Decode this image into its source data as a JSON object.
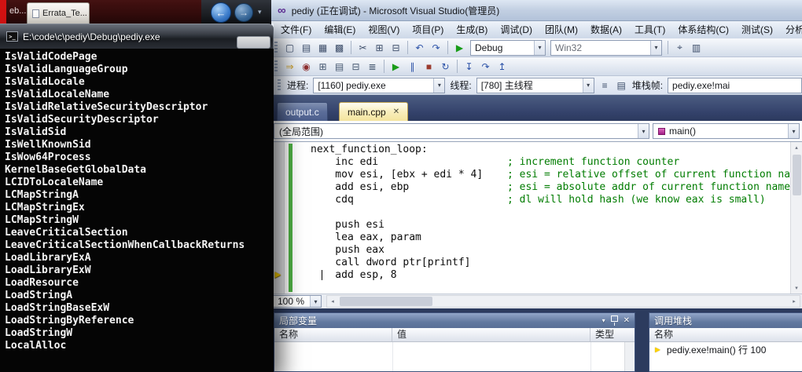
{
  "ui": {
    "dropdown_glyph": "▾",
    "close_glyph": "✕",
    "scroll_left": "◂",
    "scroll_right": "▸",
    "scroll_up": "▴",
    "scroll_down": "▾"
  },
  "background": {
    "edge_tab_label": "eb...",
    "tab_label": "Errata_Te...",
    "back_glyph": "←",
    "forward_glyph": "→",
    "chevron_glyph": "▾"
  },
  "console": {
    "icon_glyph": ">_",
    "title": "E:\\code\\c\\pediy\\Debug\\pediy.exe",
    "lines": [
      "IsValidCodePage",
      "IsValidLanguageGroup",
      "IsValidLocale",
      "IsValidLocaleName",
      "IsValidRelativeSecurityDescriptor",
      "IsValidSecurityDescriptor",
      "IsValidSid",
      "IsWellKnownSid",
      "IsWow64Process",
      "KernelBaseGetGlobalData",
      "LCIDToLocaleName",
      "LCMapStringA",
      "LCMapStringEx",
      "LCMapStringW",
      "LeaveCriticalSection",
      "LeaveCriticalSectionWhenCallbackReturns",
      "LoadLibraryExA",
      "LoadLibraryExW",
      "LoadResource",
      "LoadStringA",
      "LoadStringBaseExW",
      "LoadStringByReference",
      "LoadStringW",
      "LocalAlloc"
    ]
  },
  "vs": {
    "logo_glyph": "∞",
    "title": "pediy (正在调试) - Microsoft Visual Studio(管理员)",
    "menus": [
      "文件(F)",
      "编辑(E)",
      "视图(V)",
      "项目(P)",
      "生成(B)",
      "调试(D)",
      "团队(M)",
      "数据(A)",
      "工具(T)",
      "体系结构(C)",
      "测试(S)",
      "分析(N)"
    ],
    "toolbar_main": {
      "file_icons": [
        {
          "name": "new-file-icon",
          "glyph": "▢"
        },
        {
          "name": "open-file-icon",
          "glyph": "▤"
        },
        {
          "name": "save-icon",
          "glyph": "▦"
        },
        {
          "name": "save-all-icon",
          "glyph": "▩"
        }
      ],
      "edit_icons": [
        {
          "name": "cut-icon",
          "glyph": "✂"
        },
        {
          "name": "copy-icon",
          "glyph": "⊞"
        },
        {
          "name": "paste-icon",
          "glyph": "⊟"
        }
      ],
      "history_icons": [
        {
          "name": "undo-icon",
          "glyph": "↶",
          "color": "#2d53a8"
        },
        {
          "name": "redo-icon",
          "glyph": "↷",
          "color": "#2d53a8"
        }
      ],
      "start_glyph": "▶",
      "config_value": "Debug",
      "platform_value": "Win32",
      "tool_icons": [
        {
          "name": "find-in-files-icon",
          "glyph": "⌖"
        },
        {
          "name": "solution-explorer-icon",
          "glyph": "▥"
        }
      ]
    },
    "toolbar_debug": {
      "window_icons": [
        {
          "name": "show-next-statement-icon",
          "glyph": "⇒",
          "color": "#c9991c"
        },
        {
          "name": "breakpoints-window-icon",
          "glyph": "◉",
          "color": "#8d2f2f"
        },
        {
          "name": "immediate-window-icon",
          "glyph": "⊞",
          "color": "#44566e"
        },
        {
          "name": "locals-window-icon",
          "glyph": "▤",
          "color": "#44566e"
        },
        {
          "name": "watch-window-icon",
          "glyph": "⊟",
          "color": "#44566e"
        },
        {
          "name": "callstack-window-icon",
          "glyph": "≣",
          "color": "#44566e"
        }
      ],
      "exec_icons": [
        {
          "name": "continue-icon",
          "glyph": "▶",
          "color": "#1a9c1a"
        },
        {
          "name": "break-all-icon",
          "glyph": "∥",
          "color": "#2d53a8"
        },
        {
          "name": "stop-debugging-icon",
          "glyph": "■",
          "color": "#9b3b2e"
        },
        {
          "name": "restart-icon",
          "glyph": "↻",
          "color": "#2d53a8"
        }
      ],
      "step_icons": [
        {
          "name": "step-into-icon",
          "glyph": "↧",
          "color": "#2d53a8"
        },
        {
          "name": "step-over-icon",
          "glyph": "↷",
          "color": "#2d53a8"
        },
        {
          "name": "step-out-icon",
          "glyph": "↥",
          "color": "#2d53a8"
        }
      ]
    },
    "debug_location": {
      "process_label": "进程:",
      "process_value": "[1160] pediy.exe",
      "thread_label": "线程:",
      "thread_value": "[780] 主线程",
      "frame_label": "堆栈帧:",
      "frame_value": "pediy.exe!mai",
      "icons": [
        {
          "name": "threads-window-icon",
          "glyph": "≡"
        },
        {
          "name": "parallel-stacks-icon",
          "glyph": "▤"
        }
      ]
    },
    "tabs": {
      "inactive_label": "output.c",
      "active_label": "main.cpp"
    },
    "navbar": {
      "scope": "(全局范围)",
      "member": "main()"
    },
    "editor": {
      "zoom": "100 %",
      "current_statement_glyph": "►",
      "lines": [
        {
          "code": "next_function_loop:",
          "comment": ""
        },
        {
          "code": "    inc edi",
          "comment": "; increment function counter"
        },
        {
          "code": "    mov esi, [ebx + edi * 4]",
          "comment": "; esi = relative offset of current function name"
        },
        {
          "code": "    add esi, ebp",
          "comment": "; esi = absolute addr of current function name"
        },
        {
          "code": "    cdq",
          "comment": "; dl will hold hash (we know eax is small)"
        },
        {
          "code": "",
          "comment": ""
        },
        {
          "code": "    push esi",
          "comment": ""
        },
        {
          "code": "    lea eax, param",
          "comment": ""
        },
        {
          "code": "    push eax",
          "comment": ""
        },
        {
          "code": "    call dword ptr[printf]",
          "comment": ""
        },
        {
          "code": "    add esp, 8",
          "comment": ""
        }
      ]
    },
    "locals": {
      "title": "局部变量",
      "columns": [
        "名称",
        "值",
        "类型"
      ]
    },
    "callstack": {
      "title": "调用堆栈",
      "column": "名称",
      "rows": [
        {
          "glyph": "►",
          "text": "pediy.exe!main() 行 100"
        }
      ]
    }
  }
}
